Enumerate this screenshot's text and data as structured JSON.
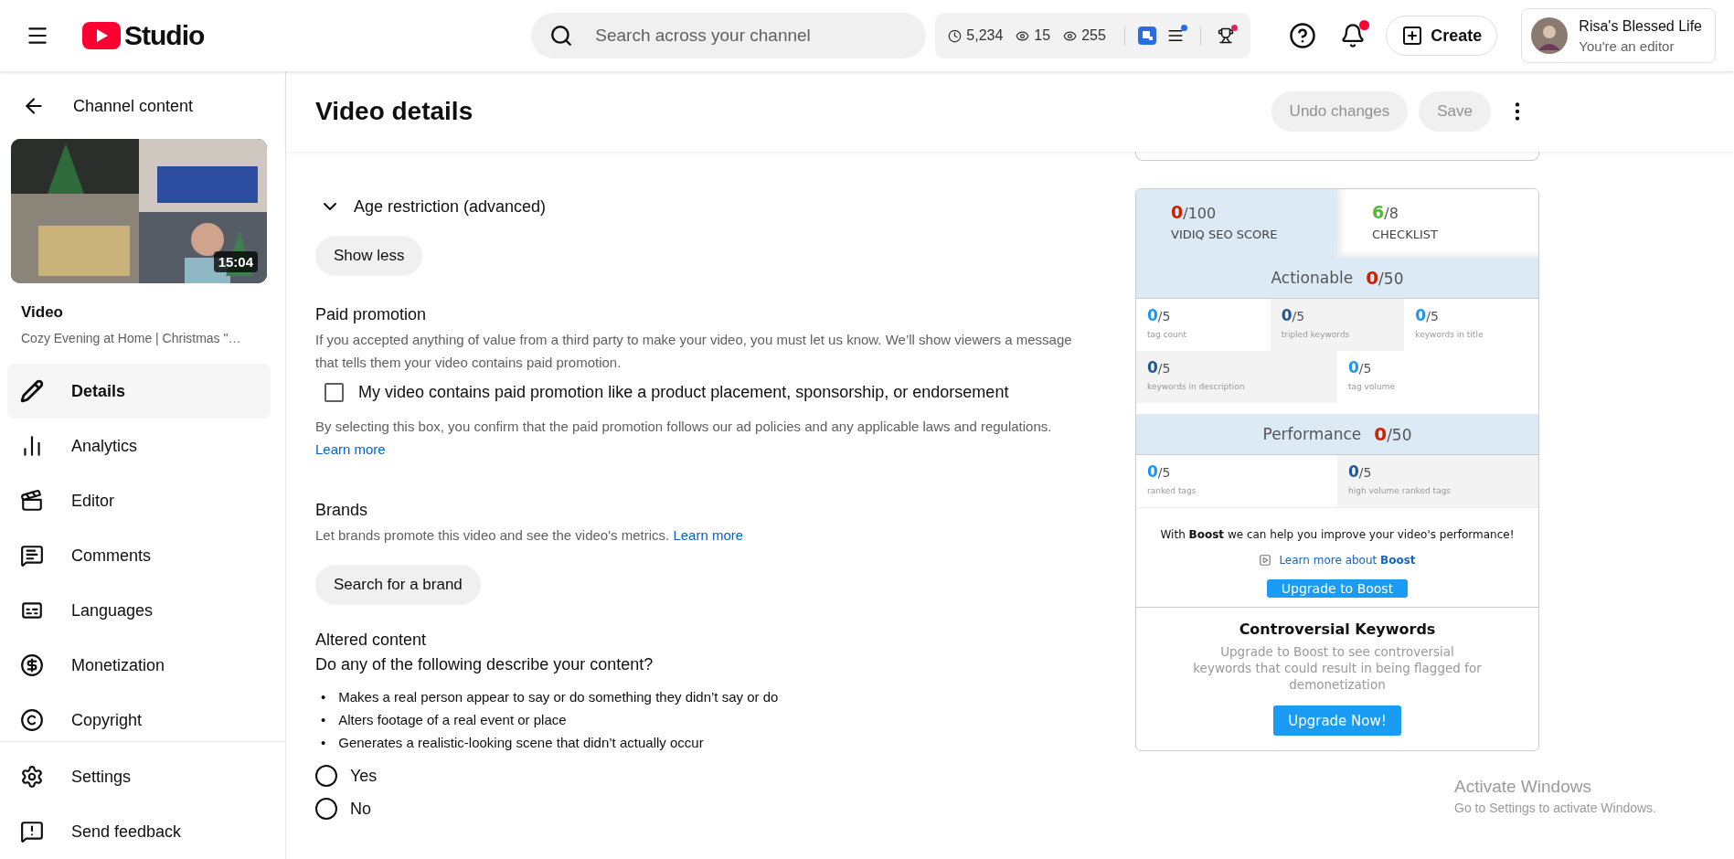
{
  "header": {
    "logo_text": "Studio",
    "search": {
      "placeholder": "Search across your channel"
    },
    "stats": [
      "5,234",
      "15",
      "255"
    ],
    "create_label": "Create",
    "account": {
      "name": "Risa's Blessed Life",
      "role": "You're an editor"
    }
  },
  "sidebar": {
    "back_label": "Channel content",
    "duration": "15:04",
    "video_heading": "Video",
    "video_title": "Cozy Evening at Home | Christmas \"…",
    "items": [
      {
        "label": "Details",
        "selected": true
      },
      {
        "label": "Analytics",
        "selected": false
      },
      {
        "label": "Editor",
        "selected": false
      },
      {
        "label": "Comments",
        "selected": false
      },
      {
        "label": "Languages",
        "selected": false
      },
      {
        "label": "Monetization",
        "selected": false
      },
      {
        "label": "Copyright",
        "selected": false
      }
    ],
    "footer_items": [
      {
        "label": "Settings"
      },
      {
        "label": "Send feedback"
      }
    ]
  },
  "page": {
    "title": "Video details",
    "actions": [
      {
        "label": "Undo changes",
        "disabled": true
      },
      {
        "label": "Save",
        "disabled": true
      }
    ]
  },
  "details": {
    "age_restriction": {
      "label": "Age restriction (advanced)",
      "expanded": true
    },
    "show_less": "Show less",
    "paid_promotion": {
      "title": "Paid promotion",
      "description": "If you accepted anything of value from a third party to make your video, you must let us know. We’ll show viewers a message that tells them your video contains paid promotion.",
      "checkbox": {
        "label": "My video contains paid promotion like a product placement, sponsorship, or endorsement",
        "checked": false
      },
      "note": "By selecting this box, you confirm that the paid promotion follows our ad policies and any applicable laws and regulations.",
      "link": "Learn more"
    },
    "brands": {
      "title": "Brands",
      "description": "Let brands promote this video and see the video's metrics.",
      "link": "Learn more",
      "button": "Search for a brand"
    },
    "altered": {
      "title": "Altered content",
      "question": "Do any of the following describe your content?",
      "bullet_marker": "•",
      "bullets": [
        "Makes a real person appear to say or do something they didn’t say or do",
        "Alters footage of a real event or place",
        "Generates a realistic-looking scene that didn’t actually occur"
      ],
      "options": [
        {
          "label": "Yes",
          "selected": false
        },
        {
          "label": "No",
          "selected": false
        }
      ]
    }
  },
  "vidiq": {
    "tabs": [
      {
        "score": "0",
        "total": "/100",
        "label": "VIDIQ SEO SCORE",
        "color": "#cc2200",
        "selected": true
      },
      {
        "score": "6",
        "total": "/8",
        "label": "CHECKLIST",
        "color": "#55b833",
        "selected": false
      }
    ],
    "sections": [
      {
        "title": "Actionable",
        "score": "0",
        "total": "/50",
        "rows": [
          [
            {
              "value": "0",
              "total": "/5",
              "label": "tag count",
              "shaded": false
            },
            {
              "value": "0",
              "total": "/5",
              "label": "tripled keywords",
              "shaded": true
            },
            {
              "value": "0",
              "total": "/5",
              "label": "keywords in title",
              "shaded": false
            }
          ],
          [
            {
              "value": "0",
              "total": "/5",
              "label": "keywords in description",
              "shaded": true
            },
            {
              "value": "0",
              "total": "/5",
              "label": "tag volume",
              "shaded": false
            }
          ]
        ]
      },
      {
        "title": "Performance",
        "score": "0",
        "total": "/50",
        "rows": [
          [
            {
              "value": "0",
              "total": "/5",
              "label": "ranked tags",
              "shaded": false
            },
            {
              "value": "0",
              "total": "/5",
              "label": "high volume ranked tags",
              "shaded": true
            }
          ]
        ]
      }
    ],
    "boost": {
      "text": "With **Boost** we can help you improve your video's performance!",
      "link": "Learn more about **Boost**",
      "button": "Upgrade to Boost"
    },
    "controversial": {
      "title": "Controversial Keywords",
      "text": "Upgrade to Boost to see controversial keywords that could result in being flagged for demonetization",
      "button": "Upgrade Now!"
    }
  },
  "os_notice": {
    "title": "Activate Windows",
    "subtitle": "Go to Settings to activate Windows."
  }
}
